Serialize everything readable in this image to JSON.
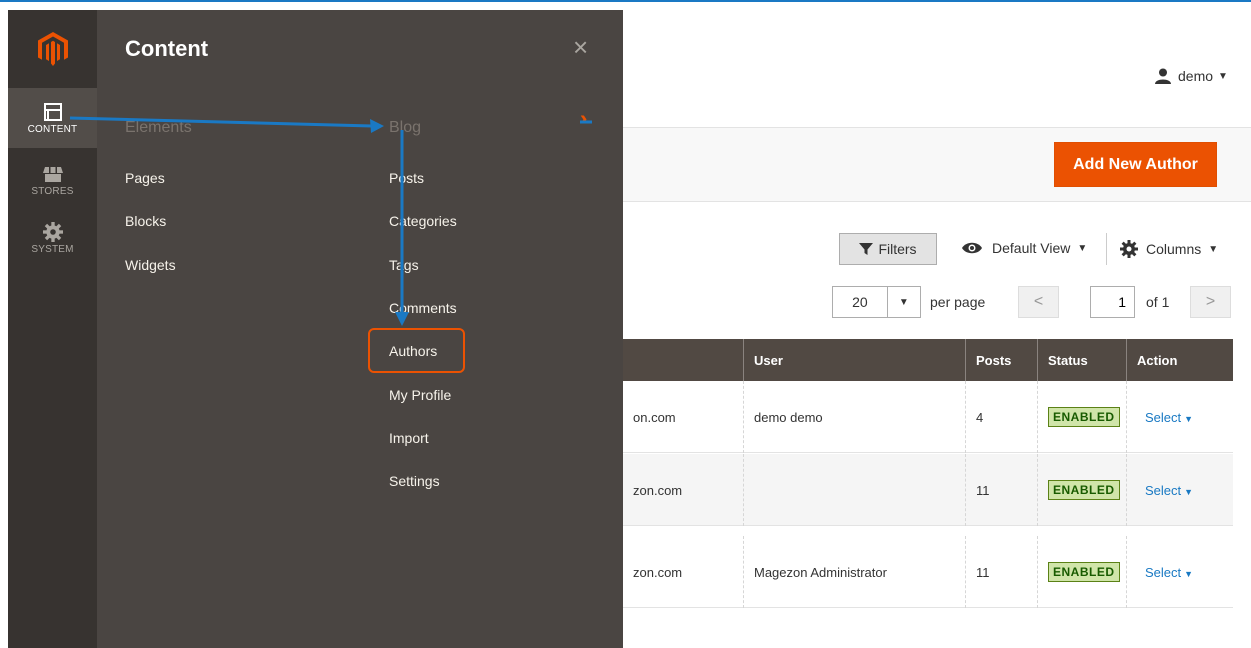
{
  "theme": {
    "accent": "#eb5202",
    "nav_bg": "#373330",
    "flyout_bg": "#4a4542",
    "annotation": "#1a79c4"
  },
  "nav": {
    "items": [
      {
        "label": "CONTENT",
        "icon": "layout-icon",
        "active": true
      },
      {
        "label": "STORES",
        "icon": "store-icon",
        "active": false
      },
      {
        "label": "SYSTEM",
        "icon": "gear-icon",
        "active": false
      }
    ]
  },
  "flyout": {
    "title": "Content",
    "close_label": "×",
    "elements": {
      "title": "Elements",
      "links": [
        "Pages",
        "Blocks",
        "Widgets"
      ]
    },
    "blog": {
      "title": "Blog",
      "links": [
        "Posts",
        "Categories",
        "Tags",
        "Comments",
        "Authors",
        "My Profile",
        "Import",
        "Settings"
      ]
    }
  },
  "header": {
    "user": "demo",
    "add_button": "Add New Author"
  },
  "toolbar": {
    "filters": "Filters",
    "view": "Default View",
    "columns": "Columns",
    "per_page_value": "20",
    "per_page_label": "per page",
    "page_value": "1",
    "page_of": "of 1"
  },
  "table": {
    "columns": [
      "User",
      "Posts",
      "Status",
      "Action"
    ],
    "rows": [
      {
        "email_fragment": "on.com",
        "user": "demo demo",
        "posts": "4",
        "status": "ENABLED",
        "action": "Select"
      },
      {
        "email_fragment": "zon.com",
        "user": "",
        "posts": "11",
        "status": "ENABLED",
        "action": "Select"
      },
      {
        "email_fragment": "zon.com",
        "user": "Magezon Administrator",
        "posts": "11",
        "status": "ENABLED",
        "action": "Select"
      }
    ]
  }
}
